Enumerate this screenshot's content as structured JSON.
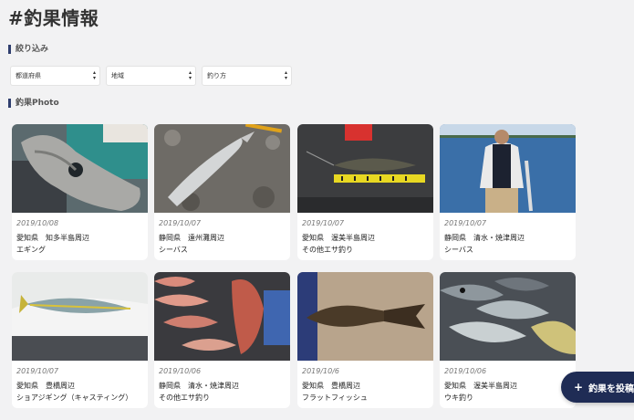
{
  "page": {
    "title": "#釣果情報"
  },
  "filter": {
    "label": "絞り込み",
    "selects": [
      {
        "value": "都道府県"
      },
      {
        "value": "地域"
      },
      {
        "value": "釣り方"
      }
    ]
  },
  "photos": {
    "label": "釣果Photo",
    "cards": [
      {
        "date": "2019/10/08",
        "location": "愛知県　知多半島周辺",
        "method": "エギング",
        "image": "squid-photo"
      },
      {
        "date": "2019/10/07",
        "location": "静岡県　遠州灘周辺",
        "method": "シーバス",
        "image": "seabass-on-rocks-photo"
      },
      {
        "date": "2019/10/07",
        "location": "愛知県　渥美半島周辺",
        "method": "その他エサ釣り",
        "image": "fish-with-ruler-photo"
      },
      {
        "date": "2019/10/07",
        "location": "静岡県　清水・焼津周辺",
        "method": "シーバス",
        "image": "angler-holding-fish-photo"
      },
      {
        "date": "2019/10/07",
        "location": "愛知県　豊橋周辺",
        "method": "ショアジギング（キャスティング）",
        "image": "yellowtail-photo"
      },
      {
        "date": "2019/10/06",
        "location": "静岡県　清水・焼津周辺",
        "method": "その他エサ釣り",
        "image": "red-sea-breams-photo"
      },
      {
        "date": "2019/10/6",
        "location": "愛知県　豊橋周辺",
        "method": "フラットフィッシュ",
        "image": "flathead-on-sand-photo"
      },
      {
        "date": "2019/10/06",
        "location": "愛知県　渥美半島周辺",
        "method": "ウキ釣り",
        "image": "fish-catch-pile-photo"
      }
    ]
  },
  "post_button": {
    "label": "釣果を投稿す"
  }
}
